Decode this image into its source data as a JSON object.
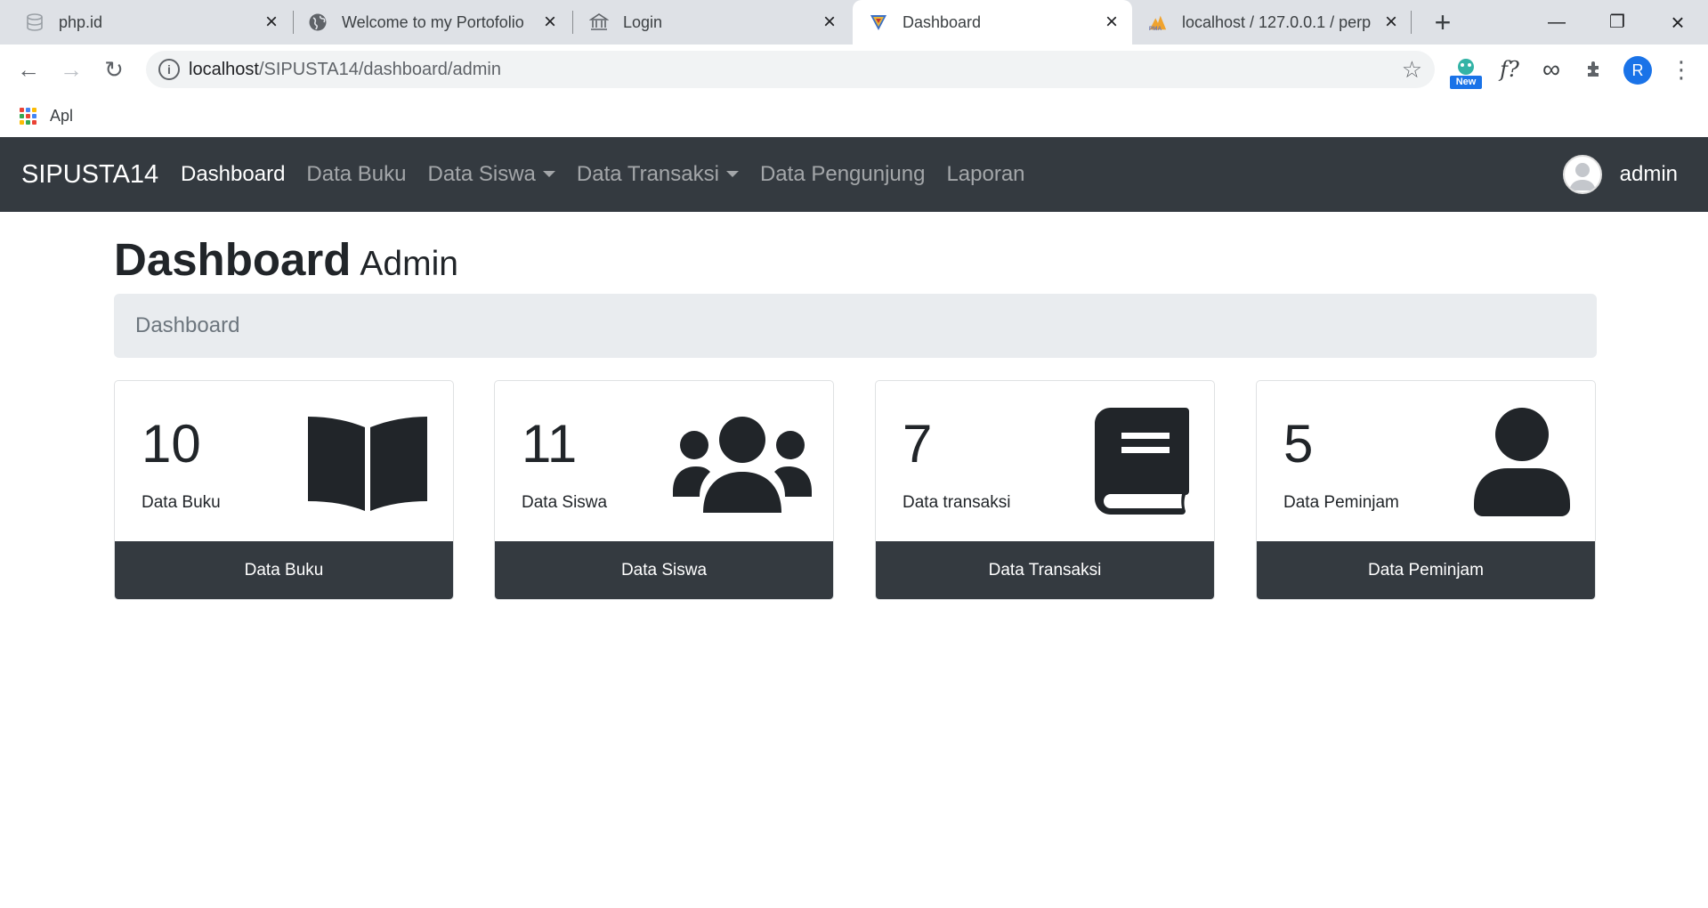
{
  "browser": {
    "tabs": [
      {
        "title": "php.id",
        "icon": "database-icon"
      },
      {
        "title": "Welcome to my Portofolio",
        "icon": "globe-icon"
      },
      {
        "title": "Login",
        "icon": "bank-icon"
      },
      {
        "title": "Dashboard",
        "icon": "shield-logo-icon",
        "active": true
      },
      {
        "title": "localhost / 127.0.0.1 / perp",
        "icon": "phpmyadmin-icon"
      }
    ],
    "url_host": "localhost",
    "url_path": "/SIPUSTA14/dashboard/admin",
    "extension_badge": "New",
    "profile_initial": "R",
    "bookmark_apps": "Apl"
  },
  "navbar": {
    "brand": "SIPUSTA14",
    "links": [
      {
        "label": "Dashboard",
        "active": true
      },
      {
        "label": "Data Buku"
      },
      {
        "label": "Data Siswa",
        "dropdown": true
      },
      {
        "label": "Data Transaksi",
        "dropdown": true
      },
      {
        "label": "Data Pengunjung"
      },
      {
        "label": "Laporan"
      }
    ],
    "user": "admin"
  },
  "page": {
    "title": "Dashboard",
    "subtitle": "Admin",
    "breadcrumb": "Dashboard"
  },
  "cards": [
    {
      "count": "10",
      "label": "Data Buku",
      "button": "Data Buku",
      "icon": "book-open-icon"
    },
    {
      "count": "11",
      "label": "Data Siswa",
      "button": "Data Siswa",
      "icon": "users-icon"
    },
    {
      "count": "7",
      "label": "Data transaksi",
      "button": "Data Transaksi",
      "icon": "book-icon"
    },
    {
      "count": "5",
      "label": "Data Peminjam",
      "button": "Data Peminjam",
      "icon": "user-icon"
    }
  ],
  "colors": {
    "navbar": "#343a40",
    "breadcrumb_bg": "#e9ecef",
    "card_footer": "#343a40",
    "text": "#212529"
  }
}
